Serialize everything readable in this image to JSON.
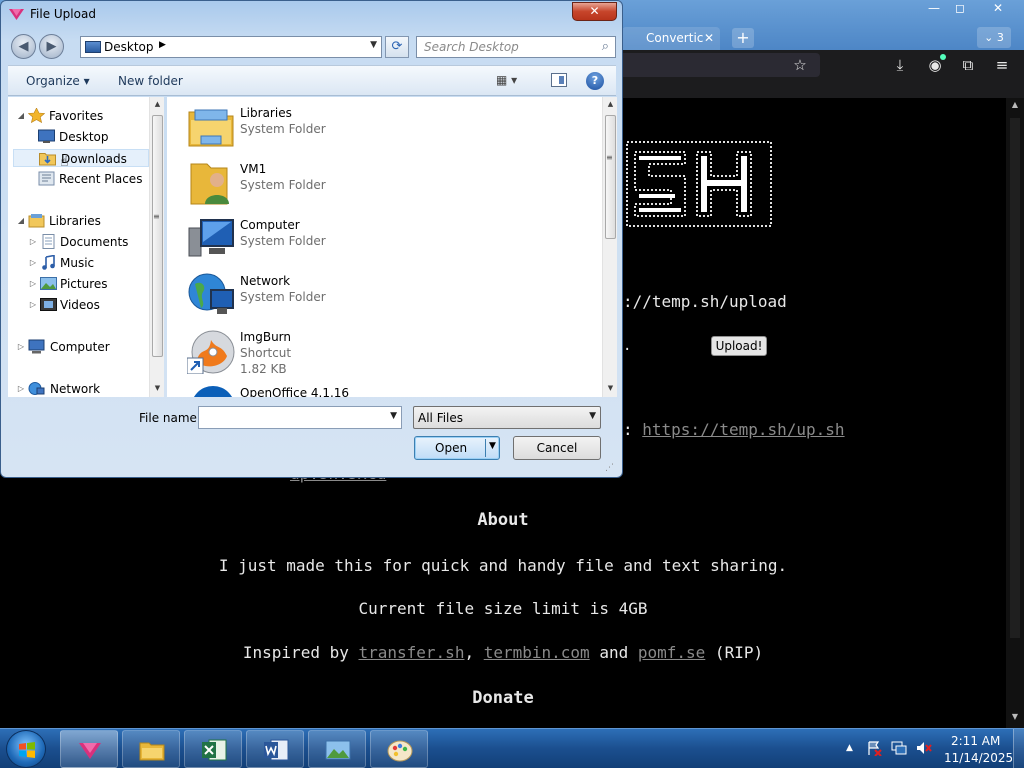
{
  "browser": {
    "tab_label": "Convertic",
    "tab_close": "✕",
    "new_tab": "+",
    "tab_count": "3",
    "window_min": "—",
    "window_max": "◻",
    "window_close": "✕",
    "icons": [
      "bookmark-star-icon",
      "download-icon",
      "account-icon",
      "extensions-icon",
      "menu-icon"
    ]
  },
  "page": {
    "command_text": "://temp.sh/upload",
    "upload_button": "Upload!",
    "dot_text": ".",
    "script_prefix": ": ",
    "script_link": "https://temp.sh/up.sh",
    "sharex_link": "up.sh.sxcu",
    "about_heading": "About",
    "about_text": "I just made this for quick and handy file and text sharing.",
    "limit_text": "Current file size limit is 4GB",
    "inspired_prefix": "Inspired by ",
    "inspired_links": [
      "transfer.sh",
      "termbin.com",
      "pomf.se"
    ],
    "inspired_sep1": ", ",
    "inspired_sep2": " and ",
    "inspired_suffix": " (RIP)",
    "donate_heading": "Donate"
  },
  "dialog": {
    "title": "File Upload",
    "close": "✕",
    "address": {
      "location": "Desktop",
      "separator": "▶",
      "dropdown": "▼"
    },
    "refresh": "⟳",
    "search_placeholder": "Search Desktop",
    "toolbar": {
      "organize": "Organize ▾",
      "new_folder": "New folder",
      "views": "▦ ▾",
      "help": "?"
    },
    "nav": [
      {
        "label": "Favorites",
        "expander": "◢",
        "icon": "favorites-star-icon"
      },
      {
        "label": "Desktop",
        "icon": "desktop-icon"
      },
      {
        "label": "Downloads",
        "icon": "downloads-folder-icon",
        "selected": true
      },
      {
        "label": "Recent Places",
        "icon": "recent-places-icon"
      },
      {
        "label": "Libraries",
        "expander": "◢",
        "icon": "libraries-icon"
      },
      {
        "label": "Documents",
        "expander": "▷",
        "icon": "documents-icon"
      },
      {
        "label": "Music",
        "expander": "▷",
        "icon": "music-icon"
      },
      {
        "label": "Pictures",
        "expander": "▷",
        "icon": "pictures-icon"
      },
      {
        "label": "Videos",
        "expander": "▷",
        "icon": "videos-icon"
      },
      {
        "label": "Computer",
        "expander": "▷",
        "icon": "computer-icon"
      },
      {
        "label": "Network",
        "expander": "▷",
        "icon": "network-icon"
      }
    ],
    "files": [
      {
        "name": "Libraries",
        "type": "System Folder",
        "icon": "libraries-folder-icon"
      },
      {
        "name": "VM1",
        "type": "System Folder",
        "icon": "user-folder-icon"
      },
      {
        "name": "Computer",
        "type": "System Folder",
        "icon": "computer-icon"
      },
      {
        "name": "Network",
        "type": "System Folder",
        "icon": "network-globe-icon"
      },
      {
        "name": "ImgBurn",
        "type": "Shortcut",
        "size": "1.82 KB",
        "icon": "imgburn-disc-icon"
      },
      {
        "name": "OpenOffice 4.1.16",
        "type": "",
        "icon": "openoffice-icon"
      }
    ],
    "filename_label": "File name:",
    "filename_value": "",
    "filename_dropdown": "▼",
    "filetype_value": "All Files",
    "filetype_arrow": "▼",
    "open_button": "Open",
    "open_arrow": "▼",
    "cancel_button": "Cancel",
    "scroll_up": "▲",
    "scroll_down": "▼",
    "scroll_grip": "≡"
  },
  "taskbar": {
    "apps": [
      "browser-app-icon",
      "explorer-folder-icon",
      "excel-icon",
      "word-icon",
      "image-viewer-icon",
      "paint-icon"
    ],
    "tray_arrow": "▲",
    "time": "2:11 AM",
    "date": "11/14/2025"
  },
  "colors": {
    "accent": "#2d6fb7",
    "dialog_border": "#3a5f8c",
    "link": "#8a8a8a",
    "page_bg": "#000000",
    "page_text": "#e8e8e8"
  }
}
